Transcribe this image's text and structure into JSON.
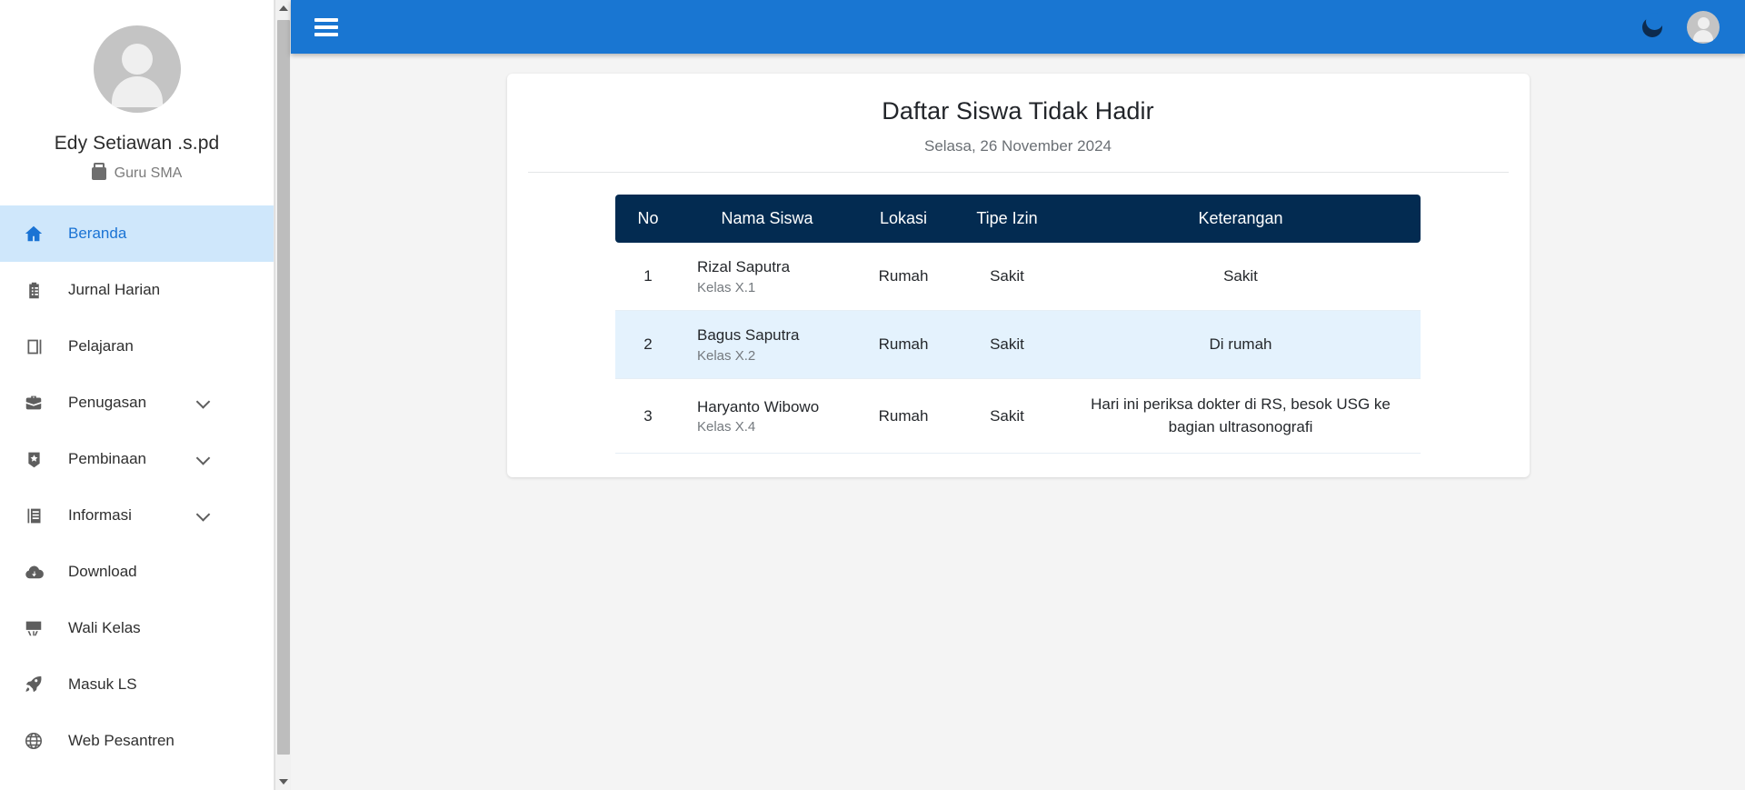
{
  "sidebar": {
    "profile": {
      "name": "Edy Setiawan .s.pd",
      "role": "Guru SMA",
      "avatar_icon": "user-avatar-icon",
      "role_icon": "briefcase-icon"
    },
    "items": [
      {
        "label": "Beranda",
        "icon": "home-icon",
        "active": true,
        "expandable": false
      },
      {
        "label": "Jurnal Harian",
        "icon": "clipboard-icon",
        "active": false,
        "expandable": false
      },
      {
        "label": "Pelajaran",
        "icon": "book-icon",
        "active": false,
        "expandable": false
      },
      {
        "label": "Penugasan",
        "icon": "briefcase-icon",
        "active": false,
        "expandable": true
      },
      {
        "label": "Pembinaan",
        "icon": "badge-icon",
        "active": false,
        "expandable": true
      },
      {
        "label": "Informasi",
        "icon": "document-icon",
        "active": false,
        "expandable": true
      },
      {
        "label": "Download",
        "icon": "cloud-download-icon",
        "active": false,
        "expandable": false
      },
      {
        "label": "Wali Kelas",
        "icon": "easel-icon",
        "active": false,
        "expandable": false
      },
      {
        "label": "Masuk LS",
        "icon": "rocket-icon",
        "active": false,
        "expandable": false
      },
      {
        "label": "Web Pesantren",
        "icon": "globe-icon",
        "active": false,
        "expandable": false
      }
    ]
  },
  "topbar": {
    "menu_toggle_icon": "hamburger-icon",
    "dark_mode_icon": "moon-icon",
    "account_icon": "user-avatar-icon",
    "background_color": "#1976d2"
  },
  "card": {
    "title": "Daftar Siswa Tidak Hadir",
    "subtitle": "Selasa, 26 November 2024",
    "table": {
      "header_color": "#032b51",
      "columns": [
        "No",
        "Nama Siswa",
        "Lokasi",
        "Tipe Izin",
        "Keterangan"
      ],
      "rows": [
        {
          "no": "1",
          "nama": "Rizal Saputra",
          "kelas": "Kelas X.1",
          "lokasi": "Rumah",
          "tipe_izin": "Sakit",
          "keterangan": "Sakit"
        },
        {
          "no": "2",
          "nama": "Bagus Saputra",
          "kelas": "Kelas X.2",
          "lokasi": "Rumah",
          "tipe_izin": "Sakit",
          "keterangan": "Di rumah"
        },
        {
          "no": "3",
          "nama": "Haryanto Wibowo",
          "kelas": "Kelas X.4",
          "lokasi": "Rumah",
          "tipe_izin": "Sakit",
          "keterangan": "Hari ini periksa dokter di RS, besok USG ke bagian ultrasonografi"
        }
      ]
    }
  },
  "scrollbar": {
    "up_arrow_icon": "chevron-up-icon",
    "down_arrow_icon": "chevron-down-icon"
  }
}
